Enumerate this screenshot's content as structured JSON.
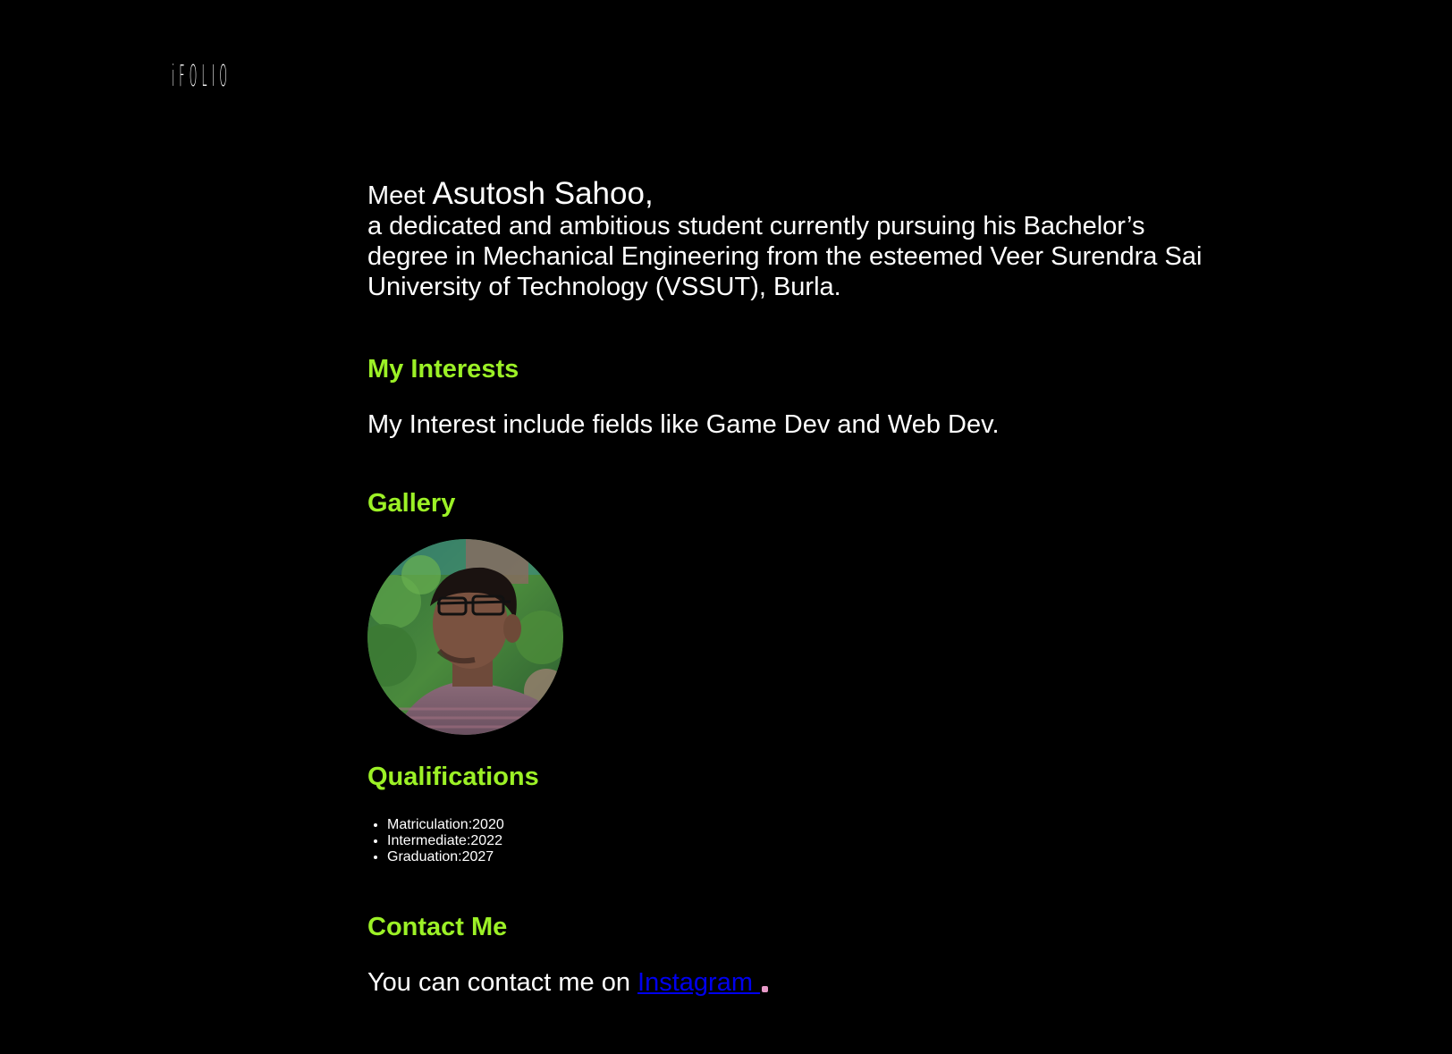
{
  "logo": {
    "text": "iFOLIO"
  },
  "intro": {
    "meet": "Meet",
    "name": "Asutosh Sahoo,",
    "description": "a dedicated and ambitious student currently pursuing his Bachelor’s degree in Mechanical Engineering from the esteemed Veer Surendra Sai University of Technology (VSSUT), Burla."
  },
  "interests": {
    "heading": "My Interests",
    "text": "My Interest include fields like Game Dev and Web Dev."
  },
  "gallery": {
    "heading": "Gallery"
  },
  "qualifications": {
    "heading": "Qualifications",
    "items": [
      "Matriculation:2020",
      "Intermediate:2022",
      "Graduation:2027"
    ]
  },
  "contact": {
    "heading": "Contact Me",
    "text": "You can contact me on ",
    "link_label": "Instagram "
  },
  "colors": {
    "background": "#000000",
    "accent": "#9cf126",
    "link": "#0000ee"
  }
}
